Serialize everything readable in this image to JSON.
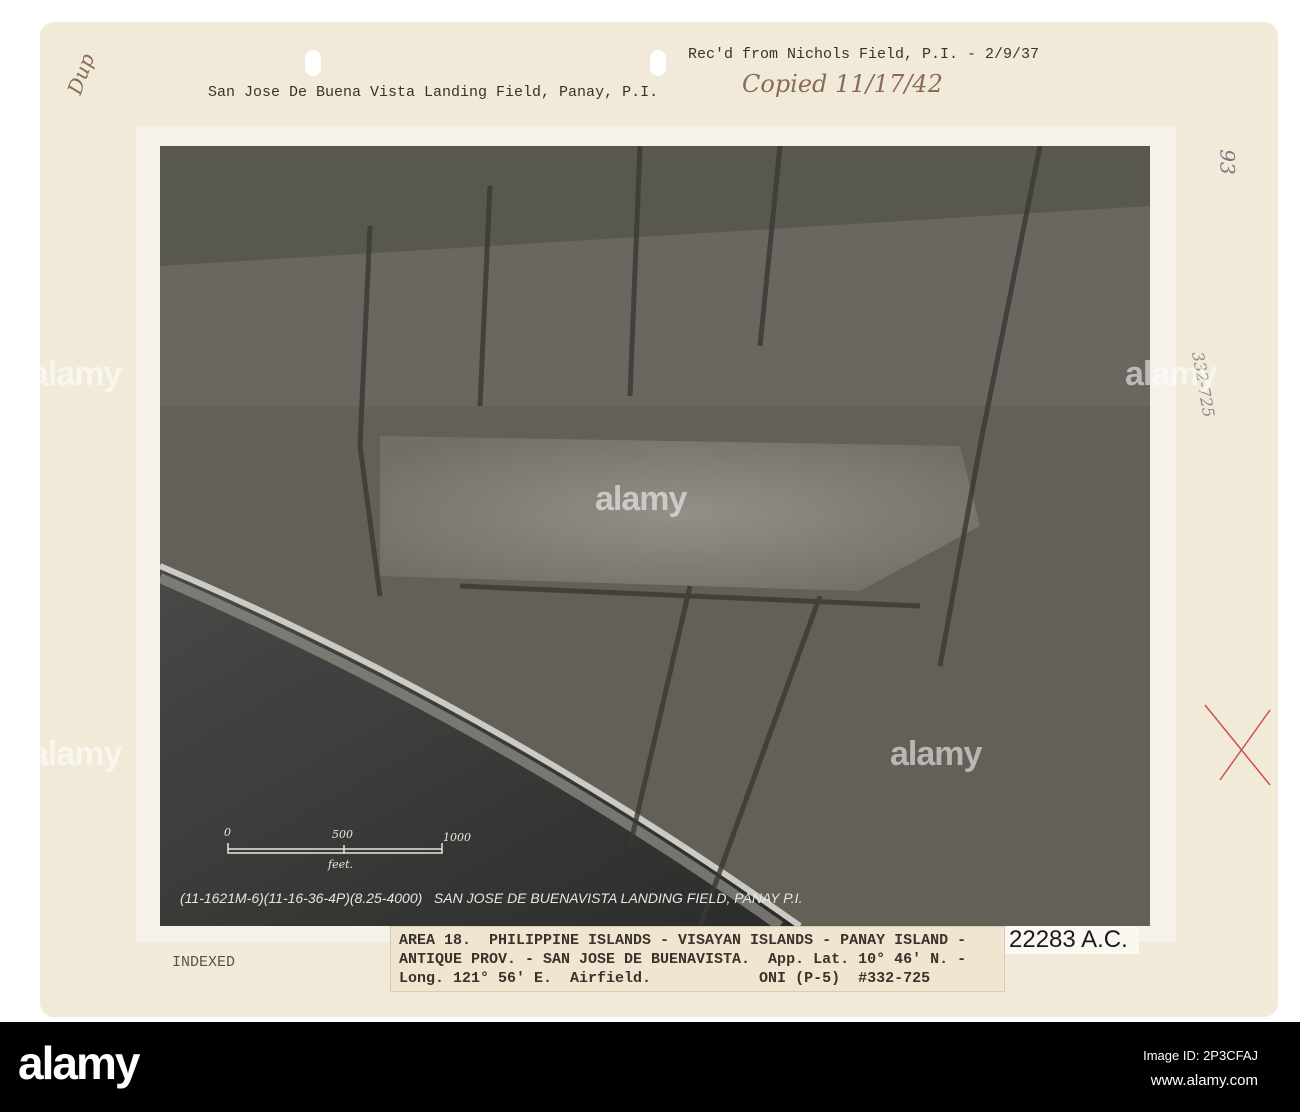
{
  "card": {
    "title": "San Jose De Buena Vista Landing Field, Panay, P.I.",
    "received": "Rec'd from Nichols Field, P.I. - 2/9/37",
    "copied_note": "Copied 11/17/42",
    "dup_note": "Dup",
    "margin_note_1": "93",
    "margin_note_2": "332-725",
    "indexed_stamp": "INDEXED",
    "photo_number": "22283 A.C.",
    "label_lines": [
      "AREA 18.  PHILIPPINE ISLANDS - VISAYAN ISLANDS - PANAY ISLAND -",
      "ANTIQUE PROV. - SAN JOSE DE BUENAVISTA.  App. Lat. 10° 46' N. -",
      "Long. 121° 56' E.  Airfield.            ONI (P-5)  #332-725"
    ]
  },
  "photo": {
    "caption": "(11-1621M-6)(11-16-36-4P)(8.25-4000)   SAN JOSE DE BUENAVISTA LANDING FIELD, PANAY P.I.",
    "scale": {
      "tick_0": "0",
      "tick_500": "500",
      "tick_1000": "1000",
      "unit": "feet."
    }
  },
  "watermark": {
    "text": "alamy"
  },
  "footer": {
    "logo": "alamy",
    "image_id": "Image ID: 2P3CFAJ",
    "url": "www.alamy.com"
  }
}
